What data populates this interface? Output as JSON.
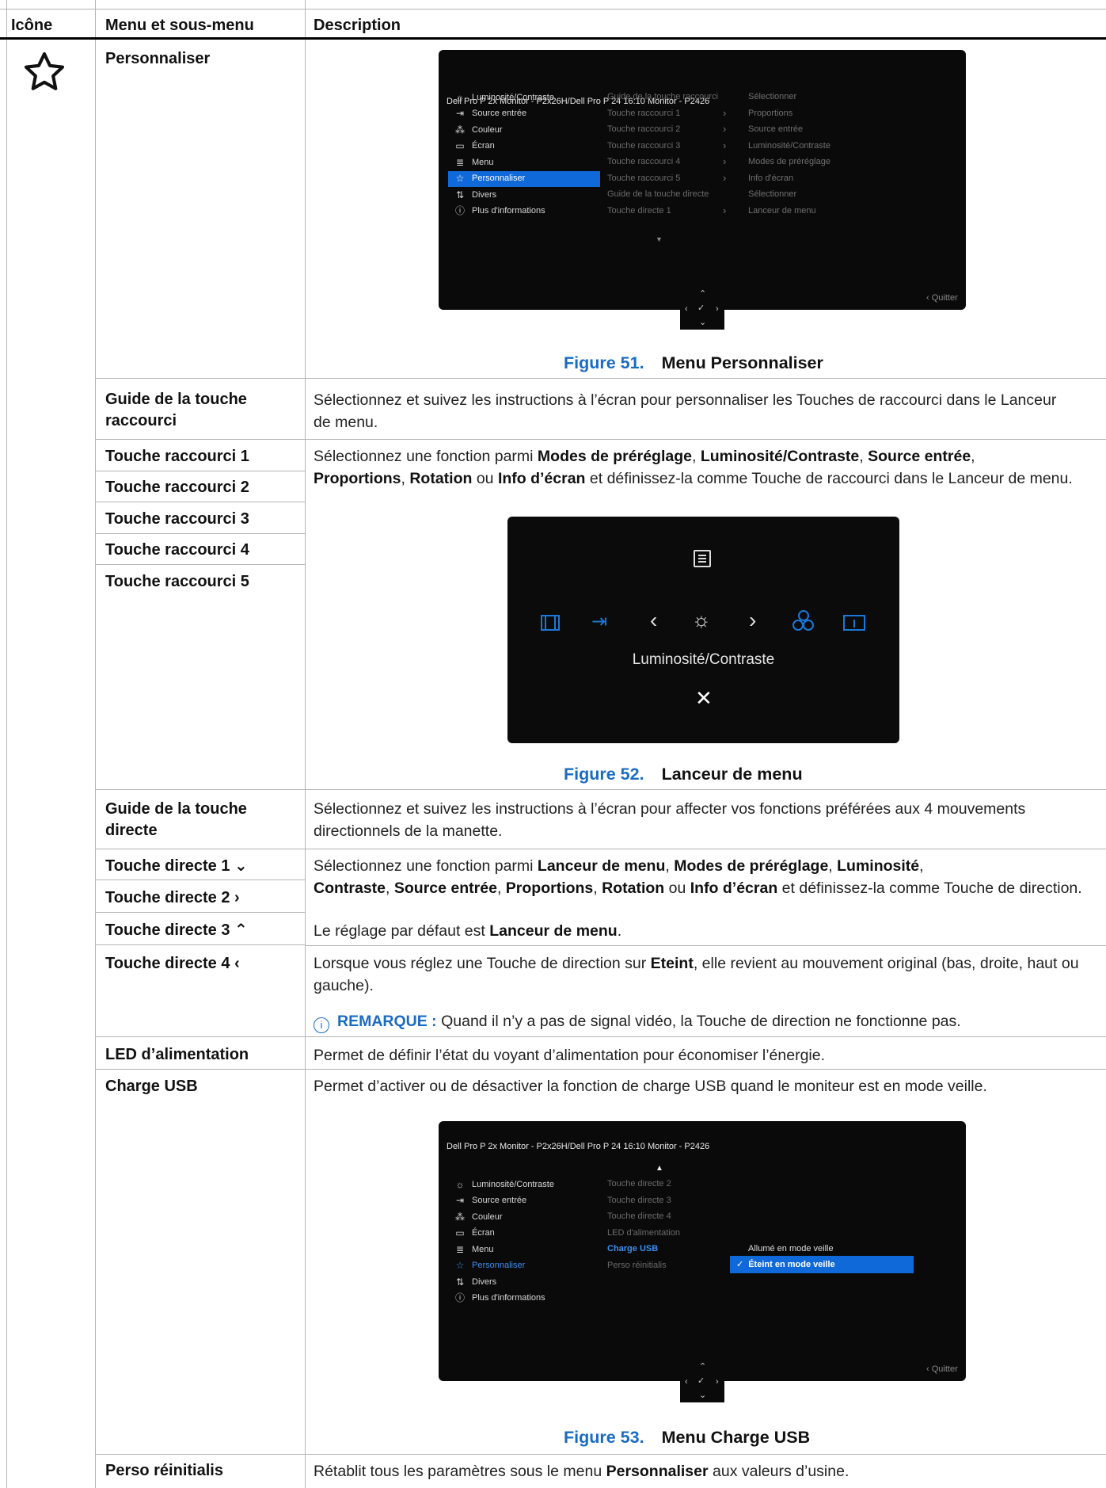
{
  "header": {
    "col1": "Icône",
    "col2": "Menu et sous-menu",
    "col3": "Description"
  },
  "icon": {
    "name": "star-icon"
  },
  "rows": {
    "personnaliser": "Personnaliser",
    "guide_raccourci": "Guide de la touche raccourci",
    "guide_raccourci_desc": "Sélectionnez et suivez les instructions à l’écran pour personnaliser les Touches de raccourci dans le Lanceur de menu.",
    "tr1": "Touche raccourci 1",
    "tr2": "Touche raccourci 2",
    "tr3": "Touche raccourci 3",
    "tr4": "Touche raccourci 4",
    "tr5": "Touche raccourci 5",
    "tr_desc": {
      "p1": "Sélectionnez une fonction parmi ",
      "b1": "Modes de préréglage",
      "s1": ", ",
      "b2": "Luminosité/Contraste",
      "s2": ", ",
      "b3": "Source entrée",
      "s3": ",",
      "b4": "Proportions",
      "s4": ", ",
      "b5": "Rotation",
      "s5": " ou ",
      "b6": "Info d’écran",
      "p2": " et définissez-la comme Touche de raccourci dans le Lanceur de menu."
    },
    "guide_directe": "Guide de la touche directe",
    "guide_directe_desc": "Sélectionnez et suivez les instructions à l’écran pour affecter vos fonctions préférées aux 4 mouvements directionnels de la manette.",
    "td1": "Touche directe 1",
    "td2": "Touche directe 2",
    "td3": "Touche directe 3",
    "td4": "Touche directe 4",
    "td_desc": {
      "p1": "Sélectionnez une fonction parmi ",
      "b1": "Lanceur de menu",
      "s1": ", ",
      "b2": "Modes de préréglage",
      "s2": ", ",
      "b3": "Luminosité",
      "s3": ",",
      "b4": "Contraste",
      "s4": ", ",
      "b5": "Source entrée",
      "s5": ", ",
      "b6": "Proportions",
      "s6": ", ",
      "b7": "Rotation",
      "s7": " ou ",
      "b8": "Info d’écran",
      "p2": " et définissez-la comme Touche de direction.",
      "default_pre": "Le réglage par défaut est ",
      "default_val": "Lanceur de menu",
      "default_post": ".",
      "off_pre": "Lorsque vous réglez une Touche de direction sur ",
      "off_val": "Eteint",
      "off_post": ", elle revient au mouvement original (bas, droite, haut ou gauche).",
      "note_label": "REMARQUE :",
      "note_text": " Quand il n’y a pas de signal vidéo, la Touche de direction ne fonctionne pas."
    },
    "led": "LED d’alimentation",
    "led_desc": "Permet de définir l’état du voyant d’alimentation pour économiser l’énergie.",
    "usb": "Charge USB",
    "usb_desc": "Permet d’activer ou de désactiver la fonction de charge USB quand le moniteur est en mode veille.",
    "reset": "Perso réinitialis",
    "reset_pre": "Rétablit tous les paramètres sous le menu ",
    "reset_bold": "Personnaliser",
    "reset_post": " aux valeurs d’usine."
  },
  "figures": {
    "f51_num": "Figure 51.",
    "f51_title": "Menu Personnaliser",
    "f52_num": "Figure 52.",
    "f52_title": "Lanceur de menu",
    "f53_num": "Figure 53.",
    "f53_title": "Menu Charge USB"
  },
  "osd": {
    "title": "Dell Pro P 2x Monitor - P2x26H/Dell Pro P 24 16:10 Monitor - P2426",
    "menu": [
      "Luminosité/Contraste",
      "Source entrée",
      "Couleur",
      "Écran",
      "Menu",
      "Personnaliser",
      "Divers",
      "Plus d'informations"
    ],
    "menu_icons": [
      "brightness-icon",
      "input-source-icon",
      "color-icon",
      "display-icon",
      "menu-icon",
      "star-icon",
      "others-icon",
      "info-icon"
    ],
    "quit": "Quitter",
    "fig51_mid": [
      "Guide de la touche raccourci",
      "Touche raccourci 1",
      "Touche raccourci 2",
      "Touche raccourci 3",
      "Touche raccourci 4",
      "Touche raccourci 5",
      "Guide de la touche directe",
      "Touche directe 1"
    ],
    "fig51_right": [
      "Sélectionner",
      "Proportions",
      "Source entrée",
      "Luminosité/Contraste",
      "Modes de préréglage",
      "Info d'écran",
      "Sélectionner",
      "Lanceur de menu"
    ],
    "fig53_mid": [
      "Touche directe 2",
      "Touche directe 3",
      "Touche directe 4",
      "LED d'alimentation",
      "Charge USB",
      "Perso réinitialis"
    ],
    "fig53_opt1": "Allumé en mode veille",
    "fig53_opt2": "Éteint en mode veille",
    "launcher_label": "Luminosité/Contraste"
  }
}
